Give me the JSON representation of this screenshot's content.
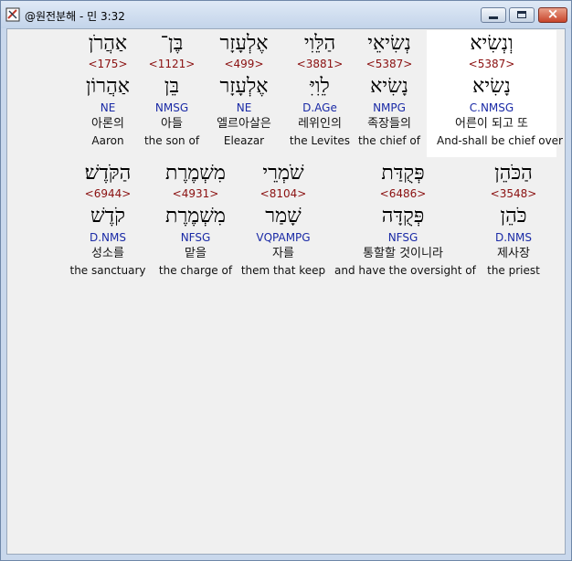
{
  "window": {
    "title": "@원전분해 - 민 3:32"
  },
  "rows": [
    [
      {
        "hebrew": "וְנְשִׂיא",
        "strong": "<5387>",
        "lemma": "נָשִׂיא",
        "morph": "C.NMSG",
        "korean": "어른이 되고 또",
        "english": "And-shall be chief over"
      },
      {
        "hebrew": "נְשִׂיאֵי",
        "strong": "<5387>",
        "lemma": "נָשִׂיא",
        "morph": "NMPG",
        "korean": "족장들의",
        "english": "the chief of"
      },
      {
        "hebrew": "הַלֵּוִי",
        "strong": "<3881>",
        "lemma": "לֵוִיִּ",
        "morph": "D.AGe",
        "korean": "레위인의",
        "english": "the Levites"
      },
      {
        "hebrew": "אֶלְעָזָר",
        "strong": "<499>",
        "lemma": "אֶלְעָזָר",
        "morph": "NE",
        "korean": "엘르아살은",
        "english": "Eleazar"
      },
      {
        "hebrew": "בֶּן־",
        "strong": "<1121>",
        "lemma": "בֵּן",
        "morph": "NMSG",
        "korean": "아들",
        "english": "the son of"
      },
      {
        "hebrew": "אַהֲרֹן",
        "strong": "<175>",
        "lemma": "אַהֲרוֹן",
        "morph": "NE",
        "korean": "아론의",
        "english": "Aaron"
      }
    ],
    [
      {
        "hebrew": "הַכֹּהֵן",
        "strong": "<3548>",
        "lemma": "כֹּהֵן",
        "morph": "D.NMS",
        "korean": "제사장",
        "english": "the priest"
      },
      {
        "hebrew": "פְּקֻדַּת",
        "strong": "<6486>",
        "lemma": "פְּקֻדָּה",
        "morph": "NFSG",
        "korean": "통할할 것이니라",
        "english": "and have the oversight of"
      },
      {
        "hebrew": "שֹׁמְרֵי",
        "strong": "<8104>",
        "lemma": "שָׁמַר",
        "morph": "VQPAMPG",
        "korean": "자를",
        "english": "them that keep"
      },
      {
        "hebrew": "מִשְׁמֶרֶת",
        "strong": "<4931>",
        "lemma": "מִשְׁמֶרֶת",
        "morph": "NFSG",
        "korean": "맡을",
        "english": "the charge of"
      },
      {
        "hebrew": "הַקֹּדֶשׁ׃",
        "strong": "<6944>",
        "lemma": "קֹדֶשׁ",
        "morph": "D.NMS",
        "korean": "성소를",
        "english": "the sanctuary"
      }
    ]
  ],
  "colors": {
    "strong": "#8a1010",
    "morph": "#1a2aa6"
  }
}
